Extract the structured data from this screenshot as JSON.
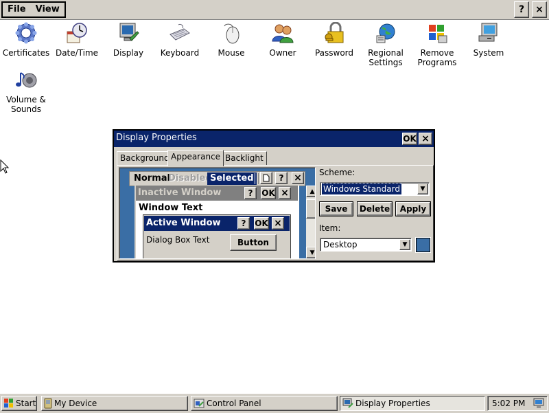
{
  "menubar": {
    "menus": [
      "File",
      "View"
    ],
    "help_label": "?",
    "close_label": "×"
  },
  "control_panel": {
    "items": [
      {
        "label": "Certificates",
        "icon": "certificates-icon"
      },
      {
        "label": "Date/Time",
        "icon": "datetime-icon"
      },
      {
        "label": "Display",
        "icon": "display-icon"
      },
      {
        "label": "Keyboard",
        "icon": "keyboard-icon"
      },
      {
        "label": "Mouse",
        "icon": "mouse-icon"
      },
      {
        "label": "Owner",
        "icon": "owner-icon"
      },
      {
        "label": "Password",
        "icon": "password-icon"
      },
      {
        "label": "Regional\nSettings",
        "icon": "regional-settings-icon"
      },
      {
        "label": "Remove\nPrograms",
        "icon": "remove-programs-icon"
      },
      {
        "label": "System",
        "icon": "system-icon"
      },
      {
        "label": "Volume &\nSounds",
        "icon": "volume-sounds-icon"
      }
    ]
  },
  "dialog": {
    "title": "Display Properties",
    "ok_label": "OK",
    "close_label": "×",
    "tabs": [
      "Background",
      "Appearance",
      "Backlight"
    ],
    "active_tab": "Appearance",
    "preview": {
      "menu_normal": "Normal",
      "menu_disabled": "Disabled",
      "menu_selected": "Selected",
      "inactive_window": "Inactive Window",
      "window_text": "Window Text",
      "active_window": "Active Window",
      "dialog_box_text": "Dialog Box Text",
      "button_label": "Button",
      "help_label": "?",
      "ok_label": "OK",
      "close_label": "×"
    },
    "scheme_label": "Scheme:",
    "scheme_value": "Windows Standard",
    "save_label": "Save",
    "delete_label": "Delete",
    "apply_label": "Apply",
    "item_label": "Item:",
    "item_value": "Desktop",
    "item_color": "#3a6ea5"
  },
  "taskbar": {
    "start_label": "Start",
    "buttons": [
      "My Device",
      "Control Panel",
      "Display Properties"
    ],
    "active_button": "Display Properties",
    "clock": "5:02 PM"
  },
  "colors": {
    "title_active": "#0a246a",
    "title_inactive": "#808080",
    "face": "#d4d0c8",
    "desktop": "#3a6ea5"
  }
}
